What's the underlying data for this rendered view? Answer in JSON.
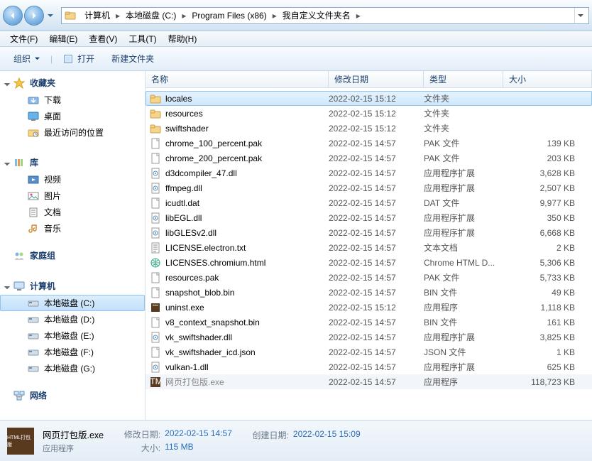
{
  "breadcrumbs": [
    "计算机",
    "本地磁盘 (C:)",
    "Program Files (x86)",
    "我自定义文件夹名"
  ],
  "menus": [
    "文件(F)",
    "编辑(E)",
    "查看(V)",
    "工具(T)",
    "帮助(H)"
  ],
  "toolbar": {
    "org": "组织",
    "open": "打开",
    "newf": "新建文件夹"
  },
  "cols": {
    "name": "名称",
    "date": "修改日期",
    "type": "类型",
    "size": "大小"
  },
  "tree": {
    "fav": {
      "head": "收藏夹",
      "items": [
        "下载",
        "桌面",
        "最近访问的位置"
      ]
    },
    "lib": {
      "head": "库",
      "items": [
        "视频",
        "图片",
        "文档",
        "音乐"
      ]
    },
    "home": "家庭组",
    "pc": {
      "head": "计算机",
      "items": [
        "本地磁盘 (C:)",
        "本地磁盘 (D:)",
        "本地磁盘 (E:)",
        "本地磁盘 (F:)",
        "本地磁盘 (G:)"
      ]
    },
    "net": "网络"
  },
  "files": [
    {
      "ico": "folder",
      "name": "locales",
      "date": "2022-02-15 15:12",
      "type": "文件夹",
      "size": "",
      "sel": true
    },
    {
      "ico": "folder",
      "name": "resources",
      "date": "2022-02-15 15:12",
      "type": "文件夹",
      "size": ""
    },
    {
      "ico": "folder",
      "name": "swiftshader",
      "date": "2022-02-15 15:12",
      "type": "文件夹",
      "size": ""
    },
    {
      "ico": "file",
      "name": "chrome_100_percent.pak",
      "date": "2022-02-15 14:57",
      "type": "PAK 文件",
      "size": "139 KB"
    },
    {
      "ico": "file",
      "name": "chrome_200_percent.pak",
      "date": "2022-02-15 14:57",
      "type": "PAK 文件",
      "size": "203 KB"
    },
    {
      "ico": "dll",
      "name": "d3dcompiler_47.dll",
      "date": "2022-02-15 14:57",
      "type": "应用程序扩展",
      "size": "3,628 KB"
    },
    {
      "ico": "dll",
      "name": "ffmpeg.dll",
      "date": "2022-02-15 14:57",
      "type": "应用程序扩展",
      "size": "2,507 KB"
    },
    {
      "ico": "file",
      "name": "icudtl.dat",
      "date": "2022-02-15 14:57",
      "type": "DAT 文件",
      "size": "9,977 KB"
    },
    {
      "ico": "dll",
      "name": "libEGL.dll",
      "date": "2022-02-15 14:57",
      "type": "应用程序扩展",
      "size": "350 KB"
    },
    {
      "ico": "dll",
      "name": "libGLESv2.dll",
      "date": "2022-02-15 14:57",
      "type": "应用程序扩展",
      "size": "6,668 KB"
    },
    {
      "ico": "txt",
      "name": "LICENSE.electron.txt",
      "date": "2022-02-15 14:57",
      "type": "文本文档",
      "size": "2 KB"
    },
    {
      "ico": "html",
      "name": "LICENSES.chromium.html",
      "date": "2022-02-15 14:57",
      "type": "Chrome HTML D...",
      "size": "5,306 KB"
    },
    {
      "ico": "file",
      "name": "resources.pak",
      "date": "2022-02-15 14:57",
      "type": "PAK 文件",
      "size": "5,733 KB"
    },
    {
      "ico": "file",
      "name": "snapshot_blob.bin",
      "date": "2022-02-15 14:57",
      "type": "BIN 文件",
      "size": "49 KB"
    },
    {
      "ico": "exe",
      "name": "uninst.exe",
      "date": "2022-02-15 15:12",
      "type": "应用程序",
      "size": "1,118 KB"
    },
    {
      "ico": "file",
      "name": "v8_context_snapshot.bin",
      "date": "2022-02-15 14:57",
      "type": "BIN 文件",
      "size": "161 KB"
    },
    {
      "ico": "dll",
      "name": "vk_swiftshader.dll",
      "date": "2022-02-15 14:57",
      "type": "应用程序扩展",
      "size": "3,825 KB"
    },
    {
      "ico": "file",
      "name": "vk_swiftshader_icd.json",
      "date": "2022-02-15 14:57",
      "type": "JSON 文件",
      "size": "1 KB"
    },
    {
      "ico": "dll",
      "name": "vulkan-1.dll",
      "date": "2022-02-15 14:57",
      "type": "应用程序扩展",
      "size": "625 KB"
    },
    {
      "ico": "app",
      "name": "网页打包版.exe",
      "date": "2022-02-15 14:57",
      "type": "应用程序",
      "size": "118,723 KB",
      "cut": true
    }
  ],
  "details": {
    "name": "网页打包版.exe",
    "type": "应用程序",
    "labels": {
      "mod": "修改日期:",
      "size": "大小:",
      "created": "创建日期:"
    },
    "mod": "2022-02-15 14:57",
    "size": "115 MB",
    "created": "2022-02-15 15:09"
  }
}
